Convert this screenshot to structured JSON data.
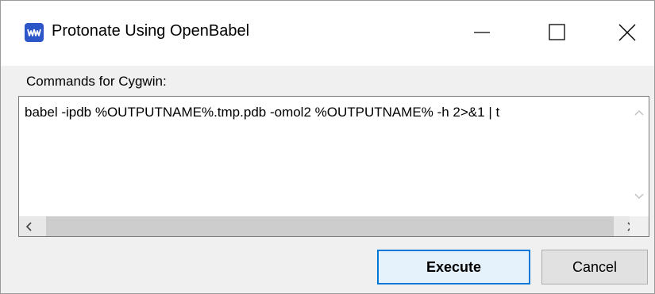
{
  "window": {
    "title": "Protonate Using OpenBabel",
    "app_icon": "app-logo-icon",
    "controls": [
      "minimize-icon",
      "maximize-icon",
      "close-icon"
    ]
  },
  "commands": {
    "label": "Commands for Cygwin:",
    "text": "babel -ipdb %OUTPUTNAME%.tmp.pdb -omol2 %OUTPUTNAME% -h 2>&1 | t"
  },
  "buttons": {
    "execute": "Execute",
    "cancel": "Cancel"
  },
  "colors": {
    "accent": "#0078d7",
    "app_icon_bg": "#2d56c8"
  }
}
